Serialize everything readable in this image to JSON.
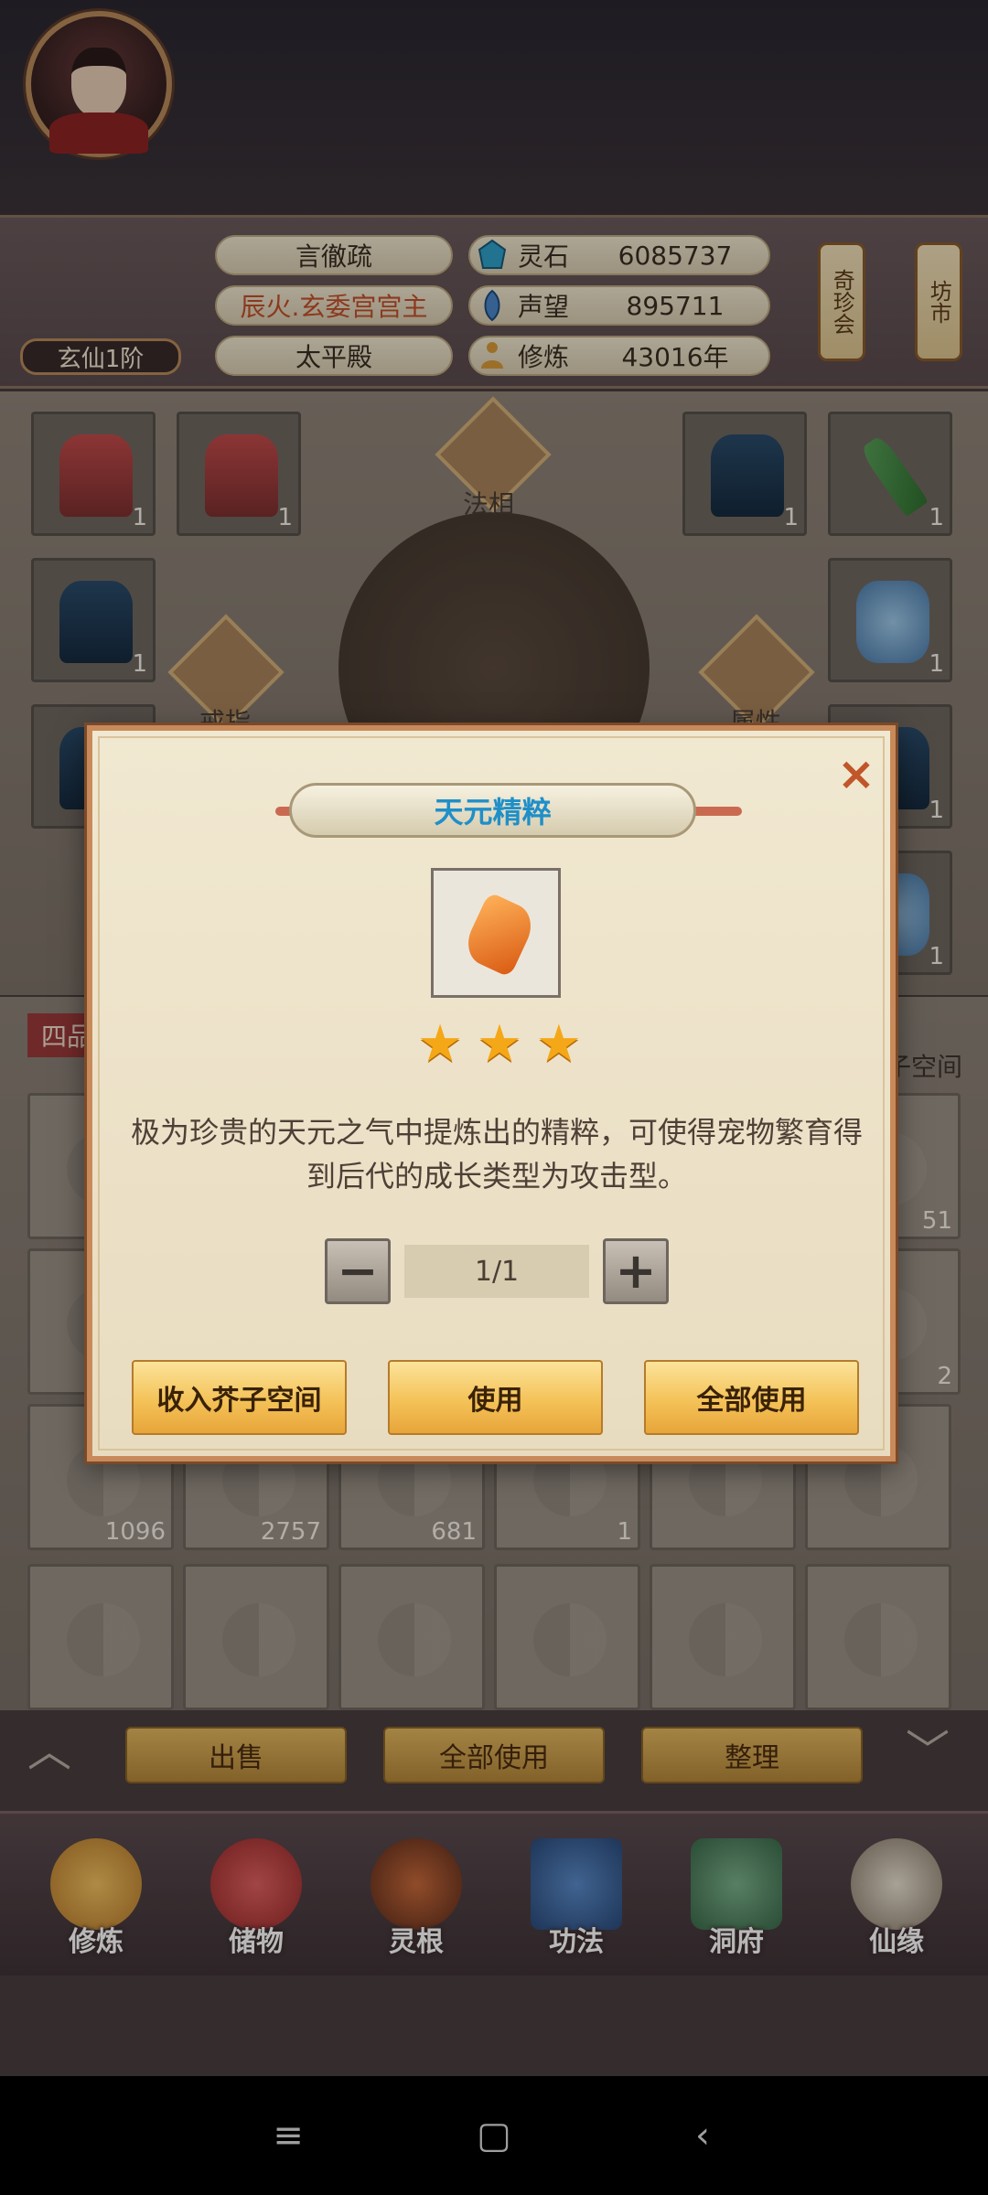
{
  "header": {
    "player_name": "言徹疏",
    "player_title": "辰火.玄委宫宫主",
    "player_hall": "太平殿",
    "rank": "玄仙1阶",
    "resources": [
      {
        "label": "灵石",
        "value": "6085737",
        "icon": "spirit-stone-icon"
      },
      {
        "label": "声望",
        "value": "895711",
        "icon": "prestige-icon"
      },
      {
        "label": "修炼",
        "value": "43016年",
        "icon": "meditation-icon"
      }
    ],
    "lanterns": [
      "奇珍会",
      "坊市"
    ]
  },
  "equipment": {
    "slot_counts": [
      "1",
      "1",
      "1",
      "1",
      "1",
      "1",
      "1",
      "1",
      "1"
    ],
    "labels": {
      "faxiang": "法相",
      "ring": "戒指",
      "attribute": "属性"
    }
  },
  "bag": {
    "tab_label": "四品",
    "space_label": "芥子空间",
    "visible_counts": [
      "51",
      "2",
      "1096",
      "2757",
      "681",
      "1"
    ],
    "buttons": [
      "出售",
      "全部使用",
      "整理"
    ]
  },
  "nav": {
    "items": [
      "修炼",
      "储物",
      "灵根",
      "功法",
      "洞府",
      "仙缘"
    ]
  },
  "dialog": {
    "title": "天元精粹",
    "stars": 3,
    "description": "极为珍贵的天元之气中提炼出的精粹，可使得宠物繁育得到后代的成长类型为攻击型。",
    "quantity": "1/1",
    "minus_label": "−",
    "plus_label": "+",
    "close_label": "×",
    "actions": [
      "收入芥子空间",
      "使用",
      "全部使用"
    ]
  },
  "system_bar": {
    "menu": "≡",
    "home": "▢",
    "back": "‹"
  }
}
